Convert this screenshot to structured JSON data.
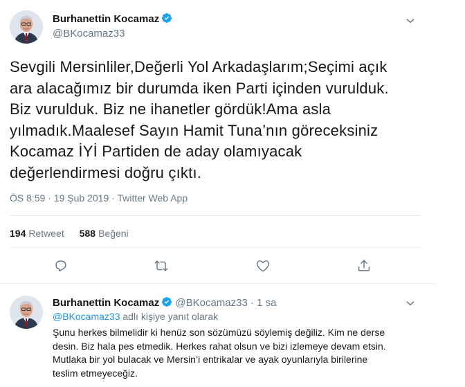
{
  "main_tweet": {
    "author_name": "Burhanettin Kocamaz",
    "author_handle": "@BKocamaz33",
    "text": "Sevgili Mersinliler,Değerli Yol Arkadaşlarım;Seçimi açık\nara alacağımız bir durumda iken Parti içinden vurulduk.\nBiz vurulduk. Biz ne ihanetler gördük!Ama asla\nyılmadık.Maalesef Sayın Hamit Tuna’nın göreceksiniz\nKocamaz İYİ Partiden de aday olamıyacak\ndeğerlendirmesi doğru çıktı.",
    "time": "ÖS 8:59",
    "sep": " · ",
    "date": "19 Şub 2019",
    "source": "Twitter Web App",
    "retweets": "194",
    "retweets_label": "Retweet",
    "likes": "588",
    "likes_label": "Beğeni",
    "icons": {
      "verified": "verified-badge-icon",
      "more": "chevron-down-icon",
      "reply": "reply-icon",
      "retweet": "retweet-icon",
      "like": "heart-icon",
      "share": "share-icon"
    }
  },
  "reply_tweet": {
    "author_name": "Burhanettin Kocamaz",
    "author_handle": "@BKocamaz33",
    "dot": "·",
    "time": "1 sa",
    "reply_mention": "@BKocamaz33",
    "reply_suffix": " adlı kişiye yanıt olarak",
    "text": "Şunu herkes bilmelidir ki henüz son sözümüzü söylemiş değiliz. Kim ne derse\ndesin. Biz hala pes etmedik. Herkes rahat olsun ve bizi izlemeye devam etsin.\nMutlaka bir yol bulacak ve Mersin’i entrikalar ve ayak oyunlarıyla birilerine\nteslim etmeyeceğiz."
  },
  "colors": {
    "accent": "#1da1f2",
    "mention": "#1b95e0",
    "secondary_text": "#657786",
    "primary_text": "#14171a",
    "divider": "#e6ecf0"
  }
}
